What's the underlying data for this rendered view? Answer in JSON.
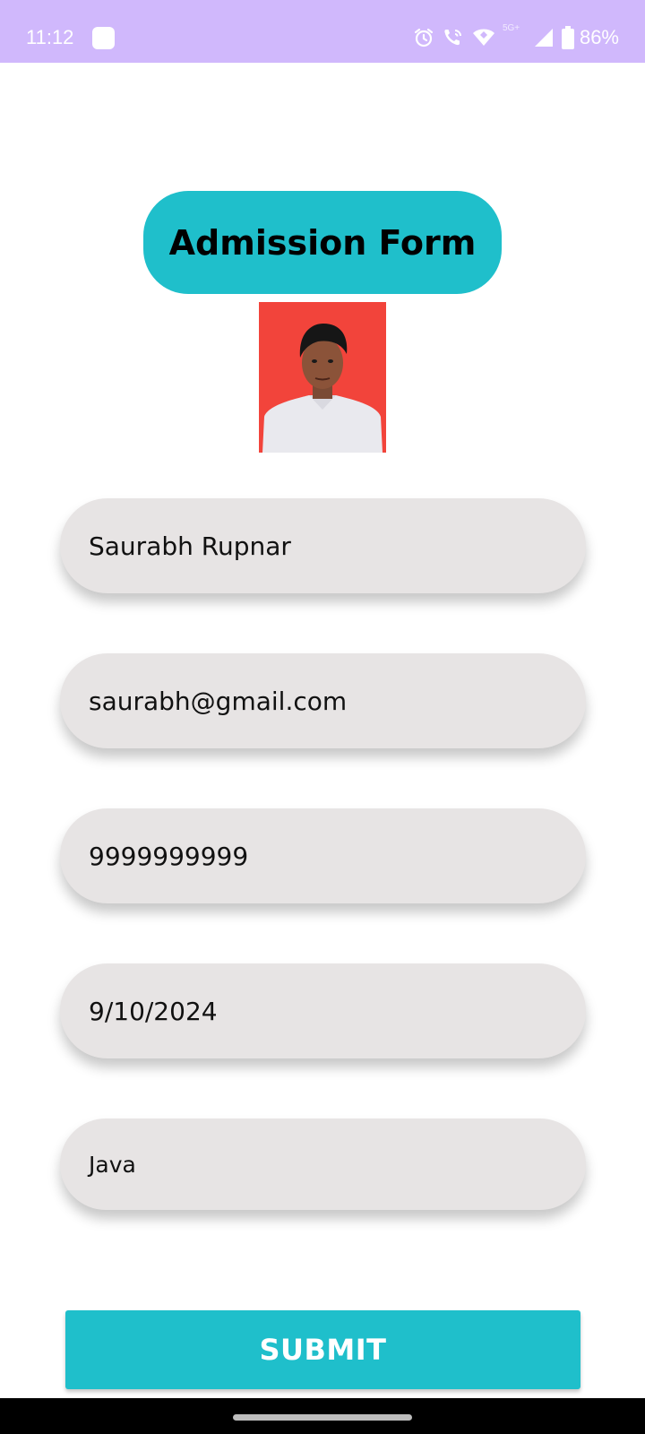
{
  "status_bar": {
    "time": "11:12",
    "network_label": "5G+",
    "battery_text": "86%",
    "background_color": "#d0b8fc"
  },
  "icons": {
    "notification": "app-notification-icon",
    "alarm": "alarm-clock-icon",
    "call": "wifi-calling-icon",
    "wifi": "wifi-icon",
    "signal": "cellular-signal-icon",
    "battery": "battery-icon"
  },
  "form": {
    "title": "Admission Form",
    "name_value": "Saurabh Rupnar",
    "email_value": "saurabh@gmail.com",
    "phone_value": "9999999999",
    "date_value": "9/10/2024",
    "course_value": "Java",
    "submit_label": "SUBMIT",
    "accent_color": "#1fbfcb",
    "field_color": "#e7e4e4",
    "photo_background": "#f2443b"
  }
}
